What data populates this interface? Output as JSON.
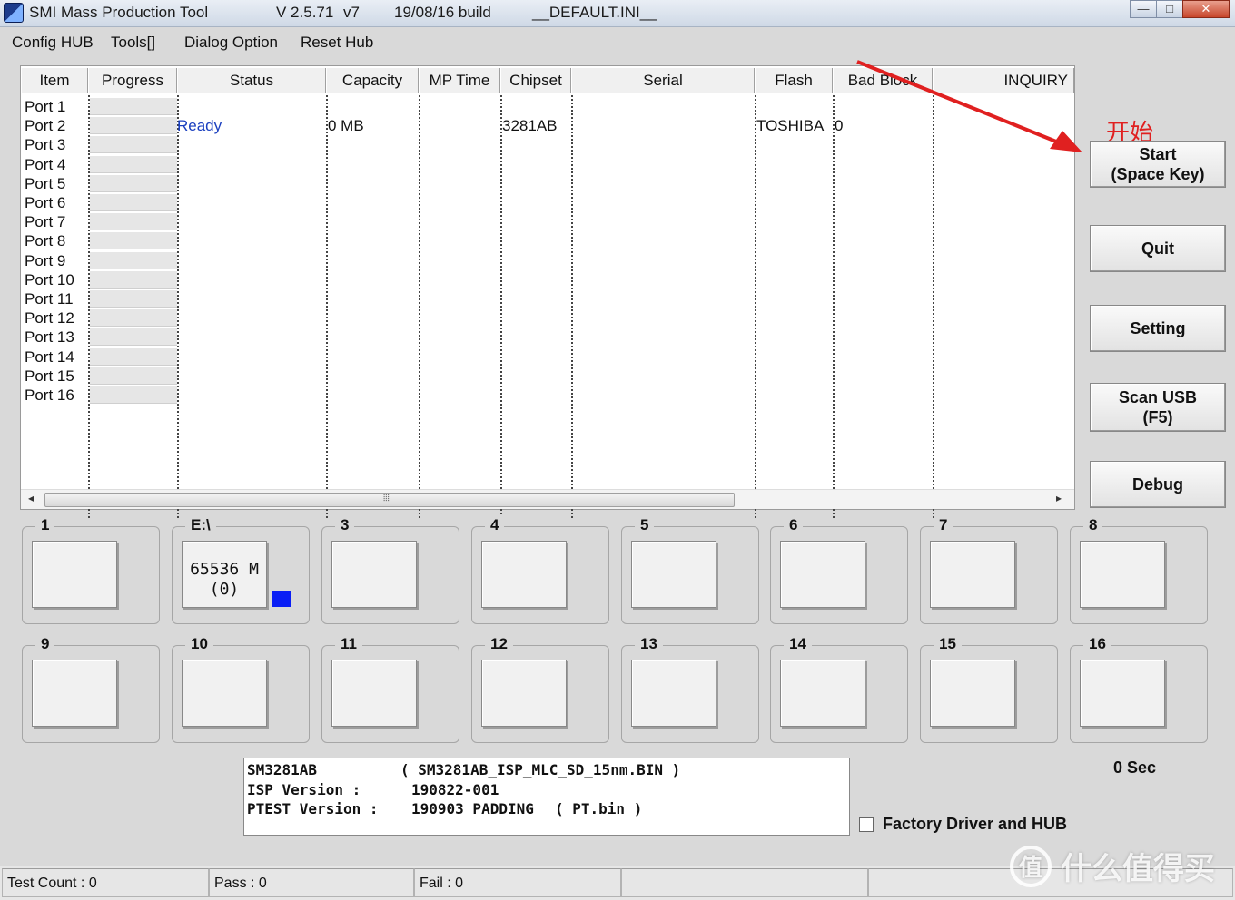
{
  "titlebar": {
    "app_title": "SMI Mass Production Tool",
    "version": "V 2.5.71",
    "variant": "v7",
    "build": "19/08/16 build",
    "ini": "__DEFAULT.INI__",
    "min": "—",
    "max": "□",
    "close": "✕"
  },
  "menu": {
    "config_hub": "Config HUB",
    "tools": "Tools[]",
    "dialog_option": "Dialog Option",
    "reset_hub": "Reset Hub"
  },
  "list": {
    "columns": [
      "Item",
      "Progress",
      "Status",
      "Capacity",
      "MP Time",
      "Chipset",
      "Serial",
      "Flash",
      "Bad Block",
      "INQUIRY"
    ],
    "ports": [
      "Port 1",
      "Port 2",
      "Port 3",
      "Port 4",
      "Port 5",
      "Port 6",
      "Port 7",
      "Port 8",
      "Port 9",
      "Port 10",
      "Port 11",
      "Port 12",
      "Port 13",
      "Port 14",
      "Port 15",
      "Port 16"
    ],
    "row2": {
      "status": "Ready",
      "capacity": "0 MB",
      "chipset": "3281AB",
      "flash": "TOSHIBA",
      "bad_block": "0"
    },
    "scroll_left": "◂",
    "scroll_right": "▸",
    "scroll_grip": "⦙⦙⦙"
  },
  "buttons": {
    "start_annotation": "开始",
    "start_line1": "Start",
    "start_line2": "(Space Key)",
    "quit": "Quit",
    "setting": "Setting",
    "scan_line1": "Scan USB",
    "scan_line2": "(F5)",
    "debug": "Debug"
  },
  "groups": {
    "titles": [
      "1",
      "E:\\",
      "3",
      "4",
      "5",
      "6",
      "7",
      "8",
      "9",
      "10",
      "11",
      "12",
      "13",
      "14",
      "15",
      "16"
    ],
    "drive_capacity": "65536 M",
    "drive_count": "(0)",
    "status_color": "#0a1ef5"
  },
  "info": {
    "chip": "SM3281AB",
    "isp_file": "( SM3281AB_ISP_MLC_SD_15nm.BIN )",
    "isp_label": "ISP Version :",
    "isp_value": "190822-001",
    "ptest_label": "PTEST Version :",
    "ptest_value": "190903 PADDING",
    "ptest_file": "( PT.bin )"
  },
  "timer": "0 Sec",
  "factory_label": "Factory Driver and HUB",
  "status_bar": {
    "test_count": "Test Count : 0",
    "pass": "Pass : 0",
    "fail": "Fail : 0"
  },
  "watermark": {
    "logo": "值",
    "text": "什么值得买"
  },
  "colors": {
    "annotation_red": "#e02020",
    "ready_blue": "#1a3fbf"
  }
}
